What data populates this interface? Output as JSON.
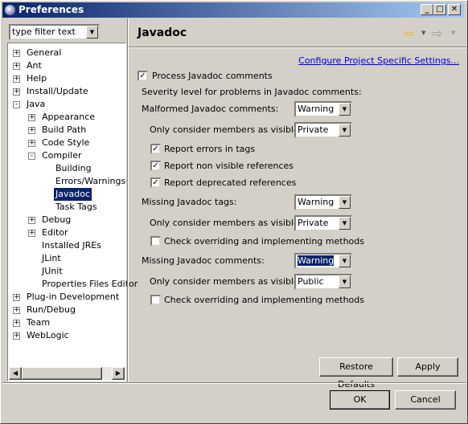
{
  "window": {
    "title": "Preferences",
    "min": "_",
    "max": "□",
    "close": "✕"
  },
  "filter": {
    "value": "type filter text"
  },
  "tree": [
    {
      "label": "General",
      "level": 0,
      "expander": "+"
    },
    {
      "label": "Ant",
      "level": 0,
      "expander": "+"
    },
    {
      "label": "Help",
      "level": 0,
      "expander": "+"
    },
    {
      "label": "Install/Update",
      "level": 0,
      "expander": "+"
    },
    {
      "label": "Java",
      "level": 0,
      "expander": "-"
    },
    {
      "label": "Appearance",
      "level": 1,
      "expander": "+"
    },
    {
      "label": "Build Path",
      "level": 1,
      "expander": "+"
    },
    {
      "label": "Code Style",
      "level": 1,
      "expander": "+"
    },
    {
      "label": "Compiler",
      "level": 1,
      "expander": "-"
    },
    {
      "label": "Building",
      "level": 2,
      "expander": ""
    },
    {
      "label": "Errors/Warnings",
      "level": 2,
      "expander": ""
    },
    {
      "label": "Javadoc",
      "level": 2,
      "expander": "",
      "selected": true
    },
    {
      "label": "Task Tags",
      "level": 2,
      "expander": ""
    },
    {
      "label": "Debug",
      "level": 1,
      "expander": "+"
    },
    {
      "label": "Editor",
      "level": 1,
      "expander": "+"
    },
    {
      "label": "Installed JREs",
      "level": 1,
      "expander": ""
    },
    {
      "label": "JLint",
      "level": 1,
      "expander": ""
    },
    {
      "label": "JUnit",
      "level": 1,
      "expander": ""
    },
    {
      "label": "Properties Files Editor",
      "level": 1,
      "expander": ""
    },
    {
      "label": "Plug-in Development",
      "level": 0,
      "expander": "+"
    },
    {
      "label": "Run/Debug",
      "level": 0,
      "expander": "+"
    },
    {
      "label": "Team",
      "level": 0,
      "expander": "+"
    },
    {
      "label": "WebLogic",
      "level": 0,
      "expander": "+"
    }
  ],
  "page": {
    "title": "Javadoc",
    "link": "Configure Project Specific Settings...",
    "process": {
      "label": "Process Javadoc comments",
      "checked": true
    },
    "severity_label": "Severity level for problems in Javadoc comments:",
    "malformed": {
      "label": "Malformed Javadoc comments:",
      "value": "Warning",
      "vis_label": "Only consider members as visible as:",
      "vis_value": "Private"
    },
    "report_errors": {
      "label": "Report errors in tags",
      "checked": true
    },
    "report_nonvisible": {
      "label": "Report non visible references",
      "checked": true
    },
    "report_deprecated": {
      "label": "Report deprecated references",
      "checked": true
    },
    "missing_tags": {
      "label": "Missing Javadoc tags:",
      "value": "Warning",
      "vis_label": "Only consider members as visible as:",
      "vis_value": "Private",
      "check_label": "Check overriding and implementing methods",
      "checked": false
    },
    "missing_comments": {
      "label": "Missing Javadoc comments:",
      "value": "Warning",
      "vis_label": "Only consider members as visible as:",
      "vis_value": "Public",
      "check_label": "Check overriding and implementing methods",
      "checked": false
    }
  },
  "buttons": {
    "restore": "Restore Defaults",
    "apply": "Apply",
    "ok": "OK",
    "cancel": "Cancel"
  }
}
